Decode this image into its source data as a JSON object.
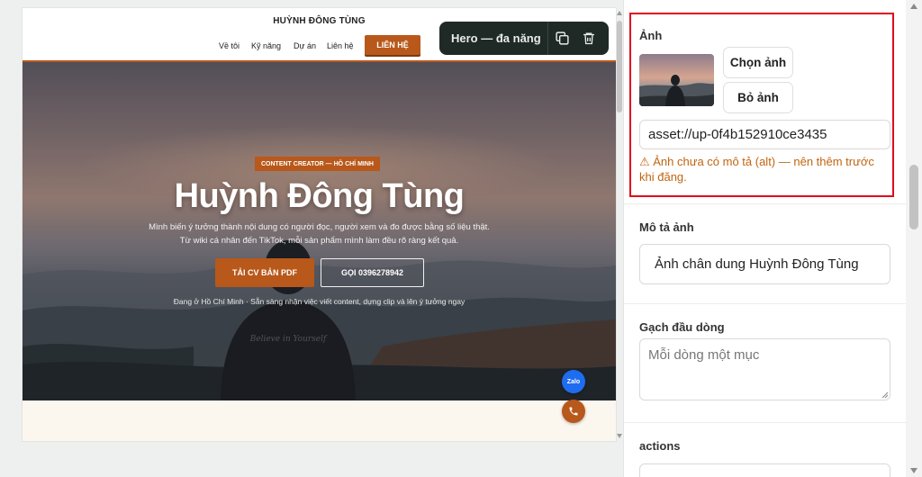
{
  "preview": {
    "brand": "HUỲNH ĐÔNG TÙNG",
    "nav": [
      "Về tôi",
      "Kỹ năng",
      "Dự án",
      "Liên hệ"
    ],
    "nav_cta": "LIÊN HỆ",
    "hero": {
      "badge": "CONTENT CREATOR — HỒ CHÍ MINH",
      "title": "Huỳnh Đông Tùng",
      "subtitle_1": "Mình biến ý tưởng thành nội dung có người đọc, người xem và đo được bằng số liệu thật.",
      "subtitle_2": "Từ wiki cá nhân đến TikTok, mỗi sản phẩm mình làm đều rõ ràng kết quả.",
      "btn_cv": "TẢI CV BẢN PDF",
      "btn_call": "GỌI 0396278942",
      "note": "Đang ở Hồ Chí Minh · Sẵn sàng nhận việc viết content, dựng clip và lên ý tưởng ngay",
      "shirt_text": "Believe in Yourself"
    },
    "zalo": "Zalo"
  },
  "toolbar": {
    "label": "Hero — đa năng",
    "icons": [
      "copy-icon",
      "trash-icon"
    ]
  },
  "panel": {
    "image_label": "Ảnh",
    "choose_image": "Chọn ảnh",
    "remove_image": "Bỏ ảnh",
    "asset_value": "asset://up-0f4b152910ce3435",
    "alt_warning": "⚠ Ảnh chưa có mô tả (alt) — nên thêm trước khi đăng.",
    "alt_label": "Mô tả ảnh",
    "alt_value": "Ảnh chân dung Huỳnh Đông Tùng",
    "bullet_label": "Gạch đầu dòng",
    "bullet_placeholder": "Mỗi dòng một mục",
    "actions_label": "actions"
  },
  "colors": {
    "accent": "#b8581a",
    "toolbar_bg": "#1f2a26",
    "highlight_frame": "#e00b1c",
    "warning": "#c26410",
    "zalo": "#1e6df0"
  }
}
